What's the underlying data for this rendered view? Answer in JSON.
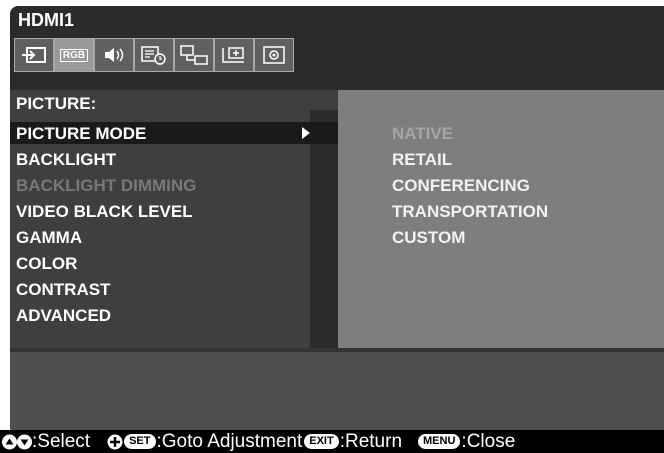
{
  "window_title": "HDMI1",
  "tabs": [
    {
      "name": "input-icon",
      "active": false
    },
    {
      "name": "rgb-icon",
      "label": "RGB",
      "active": true
    },
    {
      "name": "audio-icon",
      "active": false
    },
    {
      "name": "schedule-icon",
      "active": false
    },
    {
      "name": "network-icon",
      "active": false
    },
    {
      "name": "protect-icon",
      "active": false
    },
    {
      "name": "system-icon",
      "active": false
    }
  ],
  "menu": {
    "header": "PICTURE:",
    "items": [
      {
        "label": "PICTURE MODE",
        "selected": true
      },
      {
        "label": "BACKLIGHT"
      },
      {
        "label": "BACKLIGHT DIMMING",
        "disabled": true
      },
      {
        "label": "VIDEO BLACK LEVEL"
      },
      {
        "label": "GAMMA"
      },
      {
        "label": "COLOR"
      },
      {
        "label": "CONTRAST"
      },
      {
        "label": "ADVANCED"
      }
    ]
  },
  "options": [
    {
      "label": "NATIVE",
      "dim": true
    },
    {
      "label": "RETAIL"
    },
    {
      "label": "CONFERENCING"
    },
    {
      "label": "TRANSPORTATION"
    },
    {
      "label": "CUSTOM"
    }
  ],
  "footer": {
    "select_label": "Select",
    "set_key": "SET",
    "goto_label": "Goto Adjustment",
    "exit_key": "EXIT",
    "return_label": "Return",
    "menu_key": "MENU",
    "close_label": "Close"
  }
}
